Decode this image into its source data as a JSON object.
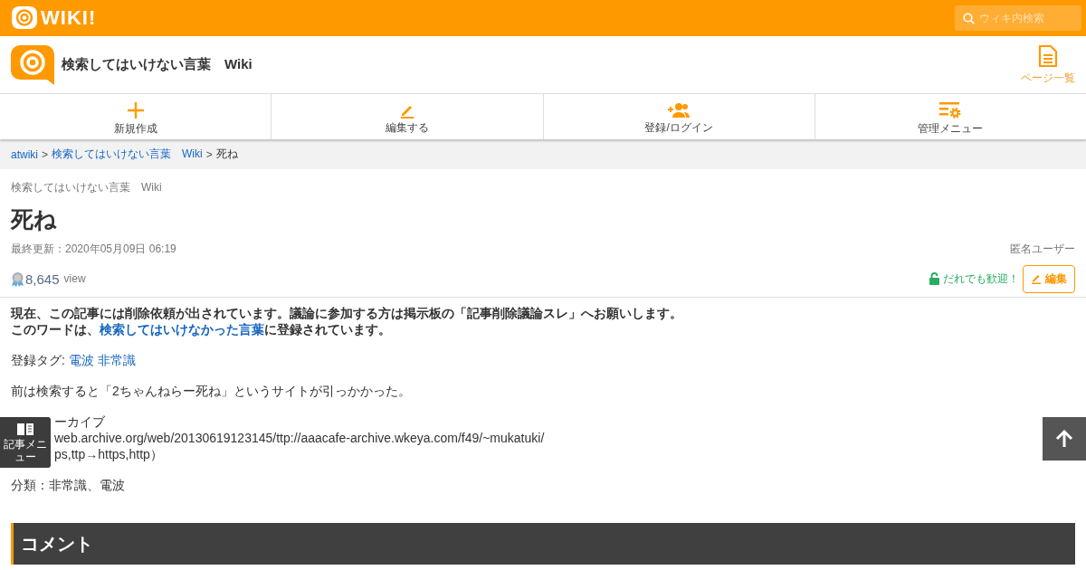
{
  "topbar": {
    "logo": "WIKI!",
    "search": {
      "placeholder": "ウィキ内検索"
    }
  },
  "header": {
    "site_title": "検索してはいけない言葉　Wiki",
    "page_list": "ページ一覧"
  },
  "nav": [
    {
      "label": "新規作成",
      "kind": "plus"
    },
    {
      "label": "編集する",
      "kind": "pencil"
    },
    {
      "label": "登録/ログイン",
      "kind": "user-add"
    },
    {
      "label": "管理メニュー",
      "kind": "admin"
    }
  ],
  "breadcrumb": [
    {
      "kind": "link",
      "text": "atwiki"
    },
    {
      "kind": "separator",
      "text": ">"
    },
    {
      "kind": "link",
      "text": "検索してはいけない言葉　Wiki"
    },
    {
      "kind": "separator",
      "text": ">"
    },
    {
      "kind": "current",
      "text": "死ね"
    }
  ],
  "page": {
    "site_name": "検索してはいけない言葉　Wiki",
    "title": "死ね",
    "updated": "最終更新：2020年05月09日 06:19",
    "author": "匿名ユーザー",
    "views": "8,645",
    "views_unit": "view",
    "permission": "だれでも歓迎！",
    "edit_button": "編集"
  },
  "article": [
    {
      "kind": "notice",
      "lines": [
        [
          {
            "kind": "text",
            "text": "現在、この記事には削除依頼が出されています。議論に参加する方は掲示板の「記事削除議論スレ」へお願いします。"
          }
        ],
        [
          {
            "kind": "text",
            "text": "このワードは、"
          },
          {
            "kind": "link",
            "text": "検索してはいけなかった言葉"
          },
          {
            "kind": "text",
            "text": "に登録されています。"
          }
        ]
      ]
    },
    {
      "kind": "tags",
      "label": "登録タグ:",
      "tags": [
        "電波",
        "非常識"
      ]
    },
    {
      "kind": "text",
      "lines": [
        "前は検索すると「2ちゃんねらー死ね」というサイトが引っかかった。"
      ]
    },
    {
      "kind": "covered",
      "lines": [
        "ーカイブ",
        "web.archive.org/web/20130619123145/ttp://aaacafe-archive.wkeya.com/f49/~mukatuki/",
        "ps,ttp→https,http）"
      ]
    },
    {
      "kind": "text",
      "lines": [
        "分類：非常識、電波"
      ]
    }
  ],
  "comment_heading": "コメント",
  "floating": {
    "article_menu": "記事メニュー"
  }
}
